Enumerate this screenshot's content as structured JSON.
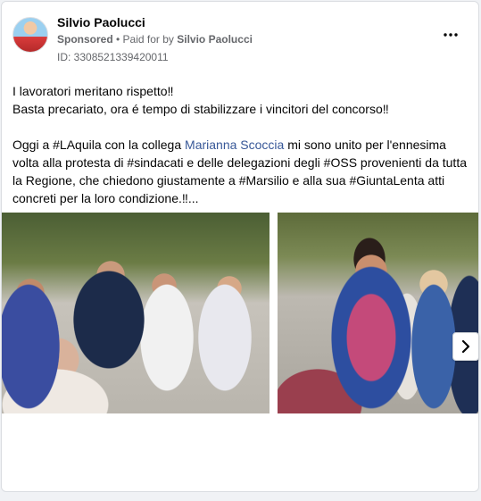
{
  "post": {
    "author": "Silvio Paolucci",
    "sponsored_label": "Sponsored",
    "paid_for_prefix": " • Paid for by ",
    "paid_for_by": "Silvio Paolucci",
    "ad_id": "ID: 3308521339420011",
    "more_icon": "more-options-icon",
    "text": {
      "line1": "I lavoratori meritano rispetto‼",
      "line2": "Basta precariato, ora é tempo di stabilizzare i vincitori del concorso‼",
      "para2_before": "Oggi a #LAquila con la collega ",
      "mention": "Marianna Scoccia",
      "para2_after": " mi sono unito per l'ennesima volta alla protesta di #sindacati e delle delegazioni degli #OSS provenienti da tutta la Regione, che chiedono giustamente a #Marsilio e alla sua #GiuntaLenta atti concreti per la loro condizione.‼..."
    }
  },
  "carousel": {
    "next_icon": "chevron-right-icon"
  },
  "colors": {
    "mention": "#385898",
    "secondary_text": "#65676b"
  }
}
